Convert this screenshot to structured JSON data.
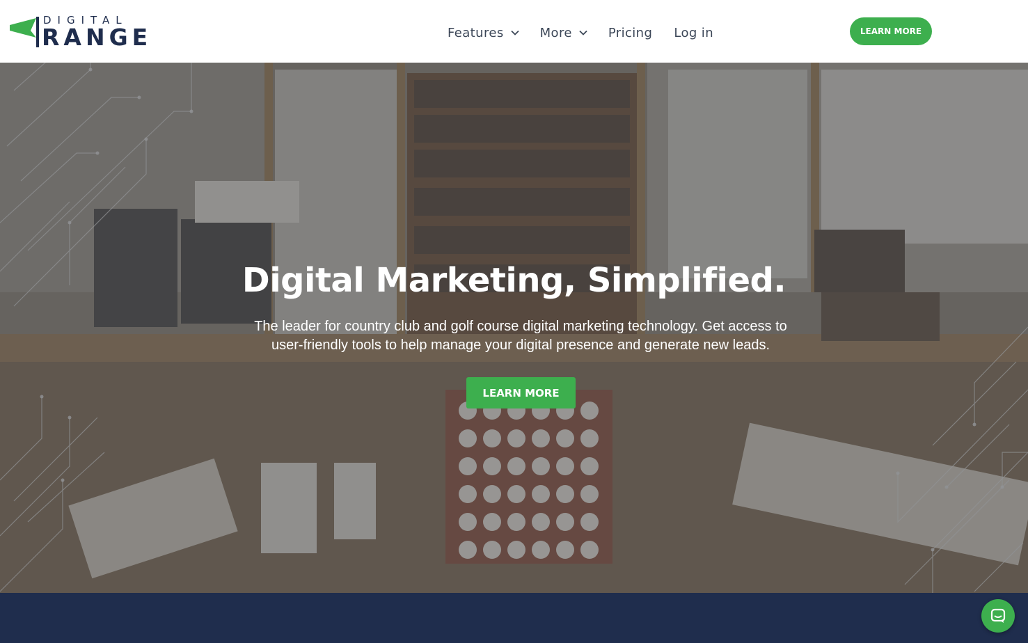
{
  "brand": {
    "logo_top": "DIGITAL",
    "logo_main": "RANGE",
    "logo_color": "#1f2d4d",
    "flag_color": "#3daf4e"
  },
  "nav": {
    "items": [
      {
        "label": "Features",
        "has_dropdown": true
      },
      {
        "label": "More",
        "has_dropdown": true
      },
      {
        "label": "Pricing",
        "has_dropdown": false
      },
      {
        "label": "Log in",
        "has_dropdown": false
      }
    ],
    "cta_label": "LEARN MORE"
  },
  "hero": {
    "title": "Digital Marketing, Simplified.",
    "subtitle_line1": "The leader for country club and golf course digital marketing technology. Get access to",
    "subtitle_line2": "user-friendly tools to help manage your digital presence and generate new leads.",
    "cta_label": "LEARN MORE"
  },
  "chat": {
    "icon": "chat-icon"
  },
  "colors": {
    "accent": "#3daf4e",
    "navy": "#1f2d4d",
    "nav_text": "#3b4657"
  }
}
